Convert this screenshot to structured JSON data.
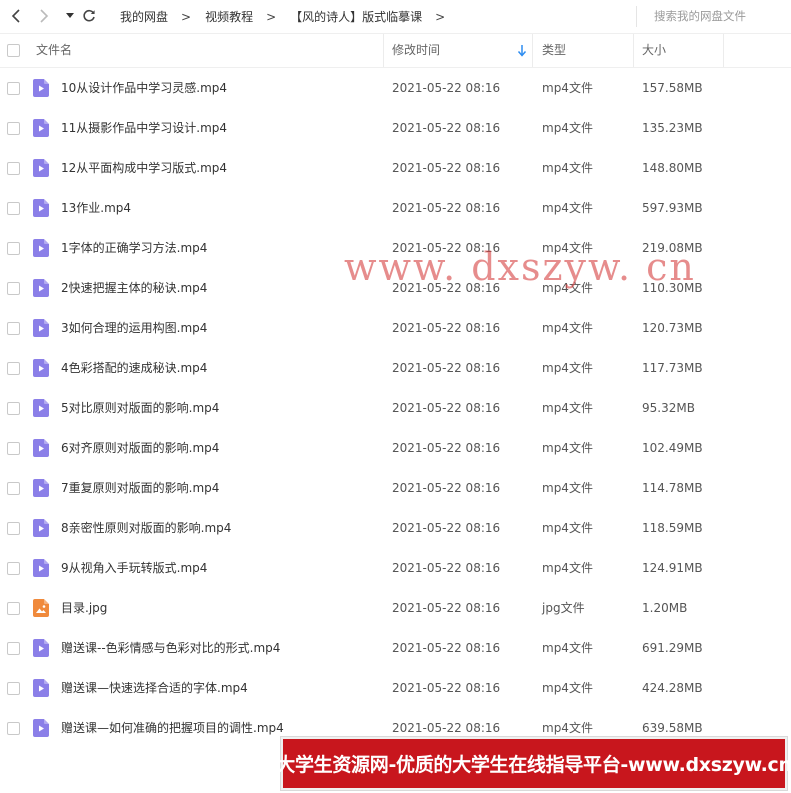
{
  "toolbar": {
    "back_icon": "chevron-left-icon",
    "forward_icon": "chevron-right-icon",
    "history_dropdown_icon": "caret-down-icon",
    "refresh_icon": "refresh-icon",
    "breadcrumb": [
      "我的网盘",
      "视频教程",
      "【风的诗人】版式临摹课"
    ],
    "search_placeholder": "搜索我的网盘文件"
  },
  "table": {
    "columns": {
      "name": "文件名",
      "time": "修改时间",
      "type": "类型",
      "size": "大小"
    },
    "sort_icon": "sort-down-arrow-icon",
    "rows": [
      {
        "name": "10从设计作品中学习灵感.mp4",
        "time": "2021-05-22 08:16",
        "type": "mp4文件",
        "size": "157.58MB",
        "icon": "video-file-icon"
      },
      {
        "name": "11从摄影作品中学习设计.mp4",
        "time": "2021-05-22 08:16",
        "type": "mp4文件",
        "size": "135.23MB",
        "icon": "video-file-icon"
      },
      {
        "name": "12从平面构成中学习版式.mp4",
        "time": "2021-05-22 08:16",
        "type": "mp4文件",
        "size": "148.80MB",
        "icon": "video-file-icon"
      },
      {
        "name": "13作业.mp4",
        "time": "2021-05-22 08:16",
        "type": "mp4文件",
        "size": "597.93MB",
        "icon": "video-file-icon"
      },
      {
        "name": "1字体的正确学习方法.mp4",
        "time": "2021-05-22 08:16",
        "type": "mp4文件",
        "size": "219.08MB",
        "icon": "video-file-icon"
      },
      {
        "name": "2快速把握主体的秘诀.mp4",
        "time": "2021-05-22 08:16",
        "type": "mp4文件",
        "size": "110.30MB",
        "icon": "video-file-icon"
      },
      {
        "name": "3如何合理的运用构图.mp4",
        "time": "2021-05-22 08:16",
        "type": "mp4文件",
        "size": "120.73MB",
        "icon": "video-file-icon"
      },
      {
        "name": "4色彩搭配的速成秘诀.mp4",
        "time": "2021-05-22 08:16",
        "type": "mp4文件",
        "size": "117.73MB",
        "icon": "video-file-icon"
      },
      {
        "name": "5对比原则对版面的影响.mp4",
        "time": "2021-05-22 08:16",
        "type": "mp4文件",
        "size": "95.32MB",
        "icon": "video-file-icon"
      },
      {
        "name": "6对齐原则对版面的影响.mp4",
        "time": "2021-05-22 08:16",
        "type": "mp4文件",
        "size": "102.49MB",
        "icon": "video-file-icon"
      },
      {
        "name": "7重复原则对版面的影响.mp4",
        "time": "2021-05-22 08:16",
        "type": "mp4文件",
        "size": "114.78MB",
        "icon": "video-file-icon"
      },
      {
        "name": "8亲密性原则对版面的影响.mp4",
        "time": "2021-05-22 08:16",
        "type": "mp4文件",
        "size": "118.59MB",
        "icon": "video-file-icon"
      },
      {
        "name": "9从视角入手玩转版式.mp4",
        "time": "2021-05-22 08:16",
        "type": "mp4文件",
        "size": "124.91MB",
        "icon": "video-file-icon"
      },
      {
        "name": "目录.jpg",
        "time": "2021-05-22 08:16",
        "type": "jpg文件",
        "size": "1.20MB",
        "icon": "image-file-icon"
      },
      {
        "name": "赠送课--色彩情感与色彩对比的形式.mp4",
        "time": "2021-05-22 08:16",
        "type": "mp4文件",
        "size": "691.29MB",
        "icon": "video-file-icon"
      },
      {
        "name": "赠送课—快速选择合适的字体.mp4",
        "time": "2021-05-22 08:16",
        "type": "mp4文件",
        "size": "424.28MB",
        "icon": "video-file-icon"
      },
      {
        "name": "赠送课—如何准确的把握项目的调性.mp4",
        "time": "2021-05-22 08:16",
        "type": "mp4文件",
        "size": "639.58MB",
        "icon": "video-file-icon"
      }
    ]
  },
  "overlay": {
    "watermark": "www. dxszyw. cn",
    "banner": "大学生资源网-优质的大学生在线指导平台-www.dxszyw.cn"
  },
  "colors": {
    "video_icon": "#8b7fe8",
    "image_icon": "#f08a3c",
    "sort_arrow": "#2d8cf0",
    "banner_bg": "#c8161d",
    "watermark": "#d74646"
  }
}
